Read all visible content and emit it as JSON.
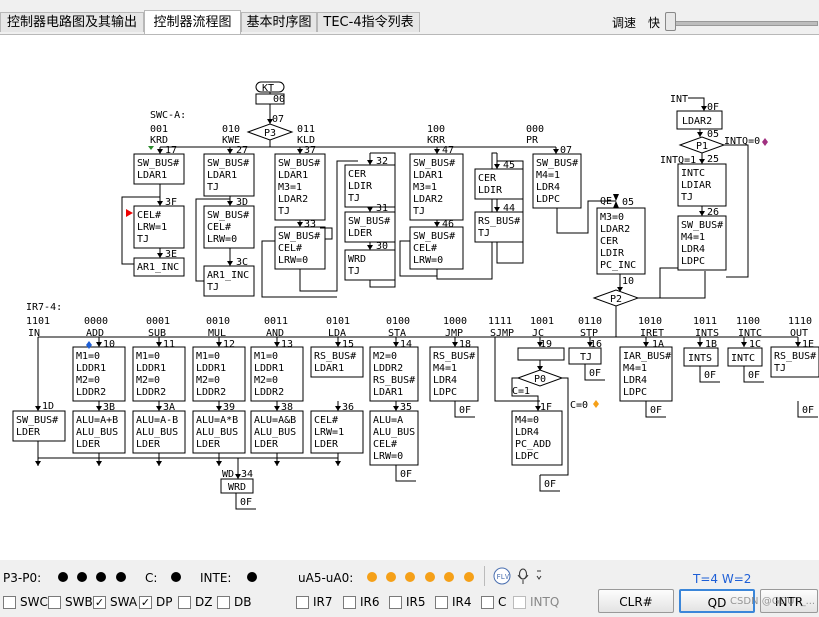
{
  "tabs": [
    {
      "label": "控制器电路图及其输出"
    },
    {
      "label": "控制器流程图"
    },
    {
      "label": "基本时序图"
    },
    {
      "label": "TEC-4指令列表"
    }
  ],
  "speed": {
    "label": "调速",
    "fast": "快"
  },
  "diagram": {
    "kt": "KT",
    "kt_addr": "00",
    "p3_addr": "07",
    "p3": "P3",
    "swc_label": "SWC-A:",
    "top_branches": [
      {
        "code": "001",
        "name": "KRD",
        "addr": "17",
        "lines": [
          "SW_BUS#",
          "LDAR1"
        ],
        "addr2": "3F",
        "lines2": [
          "CEL#",
          "LRW=1",
          "TJ"
        ],
        "addr3": "3E",
        "lines3": [
          "AR1_INC"
        ]
      },
      {
        "code": "010",
        "name": "KWE",
        "addr": "27",
        "lines": [
          "SW_BUS#",
          "LDAR1",
          "TJ"
        ],
        "addr2": "3D",
        "lines2": [
          "SW_BUS#",
          "CEL#",
          "LRW=0"
        ],
        "addr3": "3C",
        "lines3": [
          "AR1_INC",
          "TJ"
        ]
      },
      {
        "code": "011",
        "name": "KLD",
        "addr": "37",
        "lines": [
          "SW_BUS#",
          "LDAR1",
          "M3=1",
          "LDAR2",
          "TJ"
        ],
        "addr2": "33",
        "lines2": [
          "SW_BUS#",
          "CEL#",
          "LRW=0"
        ]
      },
      {
        "code": "",
        "name": "",
        "addr": "32",
        "lines": [
          "CER",
          "LDIR",
          "TJ"
        ],
        "addr2": "31",
        "lines2": [
          "SW_BUS#",
          "LDER"
        ],
        "addr3": "30",
        "lines3": [
          "WRD",
          "TJ"
        ]
      },
      {
        "code": "100",
        "name": "KRR",
        "addr": "47",
        "lines": [
          "SW_BUS#",
          "LDAR1",
          "M3=1",
          "LDAR2",
          "TJ"
        ],
        "addr2": "46",
        "lines2": [
          "SW_BUS#",
          "CEL#",
          "LRW=0"
        ]
      },
      {
        "code": "",
        "name": "",
        "addr": "45",
        "lines": [
          "CER",
          "LDIR"
        ],
        "addr2": "44",
        "lines2": [
          "RS_BUS#",
          "TJ"
        ]
      },
      {
        "code": "000",
        "name": "PR",
        "addr": "07",
        "lines": [
          "SW_BUS#",
          "M4=1",
          "LDR4",
          "LDPC"
        ]
      }
    ],
    "qe": "QE",
    "qe_addr": "05",
    "qe_lines": [
      "M3=0",
      "LDAR2",
      "CER",
      "LDIR",
      "PC_INC"
    ],
    "qe_next": "10",
    "p2": "P2",
    "int": {
      "label": "INT",
      "addr0": "0F",
      "ldar2": "LDAR2",
      "p1_addr": "05",
      "p1": "P1",
      "intq0": "INTQ=0",
      "intq1": "INTQ=1",
      "addr25": "25",
      "lines25": [
        "INTC",
        "LDIAR",
        "TJ"
      ],
      "addr26": "26",
      "lines26": [
        "SW_BUS#",
        "M4=1",
        "LDR4",
        "LDPC"
      ]
    },
    "ir_label": "IR7-4:",
    "instructions": [
      {
        "code": "1101",
        "name": "IN",
        "addr": "1D",
        "lines": [
          "SW_BUS#",
          "LDER"
        ]
      },
      {
        "code": "0000",
        "name": "ADD",
        "addr": "10",
        "lines": [
          "M1=0",
          "LDDR1",
          "M2=0",
          "LDDR2"
        ],
        "addr2": "3B",
        "lines2": [
          "ALU=A+B",
          "ALU_BUS",
          "LDER"
        ]
      },
      {
        "code": "0001",
        "name": "SUB",
        "addr": "11",
        "lines": [
          "M1=0",
          "LDDR1",
          "M2=0",
          "LDDR2"
        ],
        "addr2": "3A",
        "lines2": [
          "ALU=A-B",
          "ALU_BUS",
          "LDER"
        ]
      },
      {
        "code": "0010",
        "name": "MUL",
        "addr": "12",
        "lines": [
          "M1=0",
          "LDDR1",
          "M2=0",
          "LDDR2"
        ],
        "addr2": "39",
        "lines2": [
          "ALU=A*B",
          "ALU_BUS",
          "LDER"
        ]
      },
      {
        "code": "0011",
        "name": "AND",
        "addr": "13",
        "lines": [
          "M1=0",
          "LDDR1",
          "M2=0",
          "LDDR2"
        ],
        "addr2": "38",
        "lines2": [
          "ALU=A&B",
          "ALU_BUS",
          "LDER"
        ]
      },
      {
        "code": "0101",
        "name": "LDA",
        "addr": "15",
        "lines": [
          "RS_BUS#",
          "LDAR1"
        ],
        "addr2": "36",
        "lines2": [
          "CEL#",
          "LRW=1",
          "LDER"
        ]
      },
      {
        "code": "0100",
        "name": "STA",
        "addr": "14",
        "lines": [
          "M2=0",
          "LDDR2",
          "RS_BUS#",
          "LDAR1"
        ],
        "addr2": "35",
        "lines2": [
          "ALU=A",
          "ALU_BUS",
          "CEL#",
          "LRW=0"
        ],
        "end": "0F"
      },
      {
        "code": "1000",
        "name": "JMP",
        "addr": "18",
        "lines": [
          "RS_BUS#",
          "M4=1",
          "LDR4",
          "LDPC"
        ],
        "end": "0F"
      },
      {
        "code": "1111",
        "name": "SJMP",
        "addr": "",
        "lines": []
      },
      {
        "code": "1001",
        "name": "JC",
        "addr": "19",
        "p0": "P0",
        "c1": "C=1",
        "c0": "C=0",
        "addr2": "1F",
        "lines2": [
          "M4=0",
          "LDR4",
          "PC_ADD",
          "LDPC"
        ],
        "end": "0F"
      },
      {
        "code": "0110",
        "name": "STP",
        "addr": "16",
        "lines": [
          "TJ"
        ],
        "end": "0F"
      },
      {
        "code": "1010",
        "name": "IRET",
        "addr": "1A",
        "lines": [
          "IAR_BUS#",
          "M4=1",
          "LDR4",
          "LDPC"
        ],
        "end": "0F"
      },
      {
        "code": "1011",
        "name": "INTS",
        "addr": "1B",
        "lines": [
          "INTS"
        ],
        "end": "0F"
      },
      {
        "code": "1100",
        "name": "INTC",
        "addr": "1C",
        "lines": [
          "INTC"
        ],
        "end": "0F"
      },
      {
        "code": "1110",
        "name": "OUT",
        "addr": "1E",
        "lines": [
          "RS_BUS#",
          "TJ"
        ],
        "end": "0F"
      }
    ],
    "wd": "WD",
    "wd_addr": "34",
    "wrd": "WRD",
    "wrd_end": "0F"
  },
  "status": {
    "p3p0_label": "P3-P0:",
    "c_label": "C:",
    "inte_label": "INTE:",
    "ua_label": "uA5-uA0:",
    "tw": "T=4 W=2",
    "dot_colors": {
      "black": "#000000",
      "orange": "#f5a018",
      "accent": "#1e5fd6"
    }
  },
  "checkboxes": [
    {
      "label": "SWC",
      "checked": false
    },
    {
      "label": "SWB",
      "checked": false
    },
    {
      "label": "SWA",
      "checked": true
    },
    {
      "label": "DP",
      "checked": true
    },
    {
      "label": "DZ",
      "checked": false
    },
    {
      "label": "DB",
      "checked": false
    },
    {
      "label": "IR7",
      "checked": false
    },
    {
      "label": "IR6",
      "checked": false
    },
    {
      "label": "IR5",
      "checked": false
    },
    {
      "label": "IR4",
      "checked": false
    },
    {
      "label": "C",
      "checked": false
    },
    {
      "label": "INTQ",
      "checked": false
    }
  ],
  "buttons": {
    "clr": "CLR#",
    "qd": "QD",
    "intr": "INTR"
  },
  "watermark": "CSDN @GDUT_..."
}
